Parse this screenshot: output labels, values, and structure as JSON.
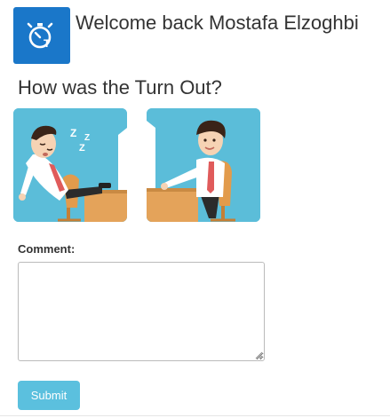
{
  "header": {
    "logo_icon": "stopwatch-icon",
    "welcome_text": "Welcome back Mostafa Elzoghbi"
  },
  "question": {
    "text": "How was the Turn Out?"
  },
  "choices": [
    {
      "id": "sleepy",
      "icon": "sleeping-employee-illustration"
    },
    {
      "id": "awake",
      "icon": "attentive-employee-illustration"
    }
  ],
  "comment": {
    "label": "Comment:",
    "value": "",
    "placeholder": ""
  },
  "submit": {
    "label": "Submit"
  },
  "colors": {
    "brand": "#1a77c9",
    "image_bg": "#5bbdd9",
    "submit_bg": "#5bc0de",
    "text": "#333333"
  }
}
